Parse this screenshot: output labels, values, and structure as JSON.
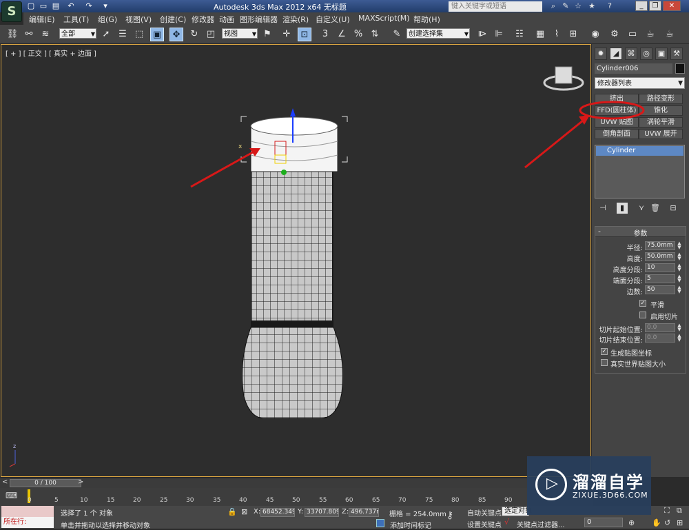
{
  "window": {
    "title": "Autodesk 3ds Max  2012 x64       无标题",
    "search_placeholder": "键入关键字或短语"
  },
  "menu": [
    "编辑(E)",
    "工具(T)",
    "组(G)",
    "视图(V)",
    "创建(C)",
    "修改器",
    "动画",
    "图形编辑器",
    "渲染(R)",
    "自定义(U)",
    "MAXScript(M)",
    "帮助(H)"
  ],
  "toolbar": {
    "selection_filter": "全部",
    "reference_coord": "视图",
    "named_selection": "创建选择集"
  },
  "viewport": {
    "label": "[ + ] [ 正交 ] [ 真实 + 边面 ]"
  },
  "command_panel": {
    "object_name": "Cylinder006",
    "object_color": "#111111",
    "modifier_list": "修改器列表",
    "modifier_buttons": [
      "挤出",
      "路径变形",
      "FFD(圆柱体)",
      "锥化",
      "UVW 贴图",
      "涡轮平滑",
      "倒角剖面",
      "UVW 展开"
    ],
    "stack_item": "Cylinder",
    "params": {
      "title": "参数",
      "fields": [
        {
          "label": "半径:",
          "value": "75.0mm"
        },
        {
          "label": "高度:",
          "value": "50.0mm"
        },
        {
          "label": "高度分段:",
          "value": "10"
        },
        {
          "label": "端面分段:",
          "value": "5"
        },
        {
          "label": "边数:",
          "value": "50"
        }
      ],
      "smooth_label": "平滑",
      "smooth_checked": true,
      "slice_on_label": "启用切片",
      "slice_on_checked": false,
      "slice_from_label": "切片起始位置:",
      "slice_from_value": "0.0",
      "slice_to_label": "切片结束位置:",
      "slice_to_value": "0.0",
      "gen_map_label": "生成贴图坐标",
      "gen_map_checked": true,
      "real_world_label": "真实世界贴图大小",
      "real_world_checked": false
    }
  },
  "timeline": {
    "frame_display": "0 / 100",
    "ticks": [
      "0",
      "5",
      "10",
      "15",
      "20",
      "25",
      "30",
      "35",
      "40",
      "45",
      "50",
      "55",
      "60",
      "65",
      "70",
      "75",
      "80",
      "85",
      "90"
    ]
  },
  "status": {
    "listener_label": "所在行:",
    "selection_text": "选择了 1 个 对象",
    "prompt_text": "单击并拖动以选择并移动对象",
    "x_label": "X:",
    "x_value": "68452.349",
    "y_label": "Y:",
    "y_value": "33707.809",
    "z_label": "Z:",
    "z_value": "496.737m",
    "grid_text": "栅格 = 254.0mm",
    "add_time_tag": "添加时间标记",
    "auto_key": "自动关键点",
    "set_key": "设置关键点",
    "selected_object": "选定对象",
    "key_filters": "关键点过滤器...",
    "current_frame": "0"
  },
  "watermark": {
    "title": "溜溜自学",
    "url": "ZIXUE.3D66.COM"
  }
}
